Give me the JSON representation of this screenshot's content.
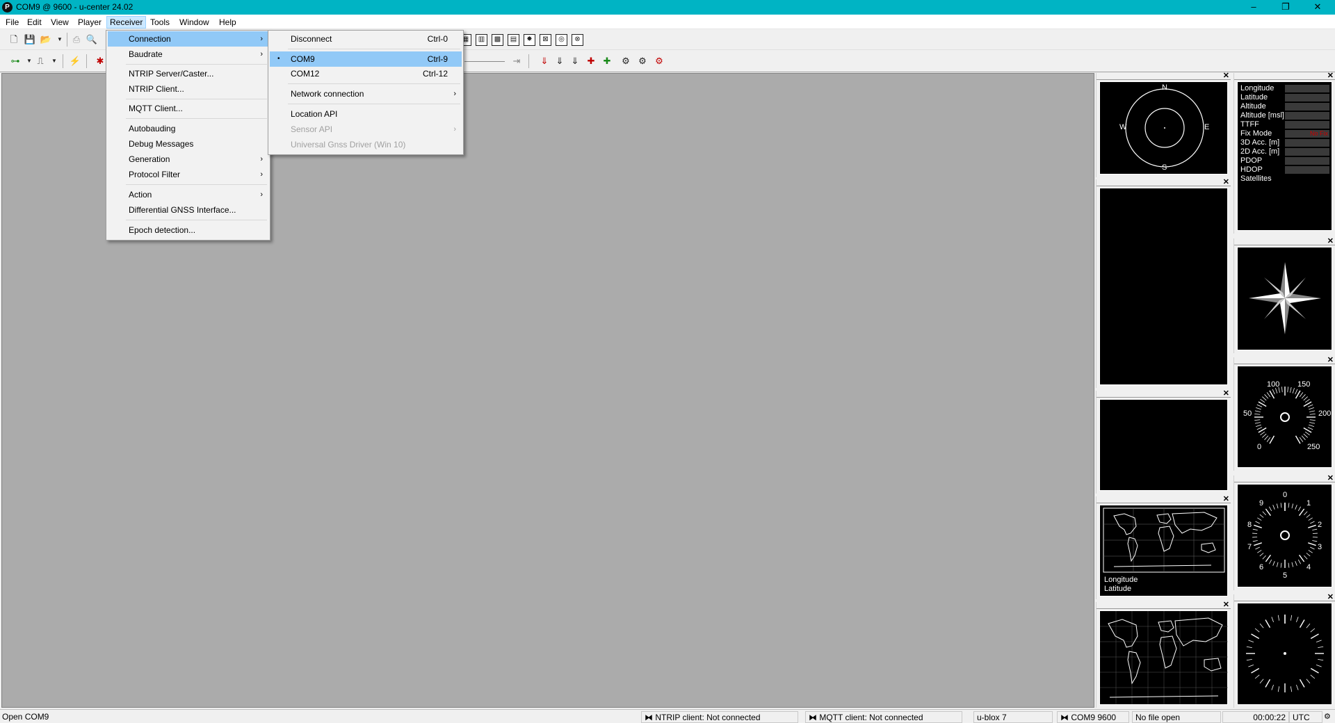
{
  "window": {
    "title": "COM9 @ 9600 - u-center 24.02",
    "app_icon": "P",
    "minimize_icon": "–",
    "maximize_icon": "❐",
    "close_icon": "✕"
  },
  "menubar": [
    "File",
    "Edit",
    "View",
    "Player",
    "Receiver",
    "Tools",
    "Window",
    "Help"
  ],
  "receiver_menu": {
    "items": [
      {
        "label": "Connection",
        "arrow": "›"
      },
      {
        "label": "Baudrate",
        "arrow": "›"
      },
      {
        "label": "NTRIP Server/Caster..."
      },
      {
        "label": "NTRIP Client..."
      },
      {
        "label": "MQTT Client..."
      },
      {
        "label": "Autobauding"
      },
      {
        "label": "Debug Messages"
      },
      {
        "label": "Generation",
        "arrow": "›"
      },
      {
        "label": "Protocol Filter",
        "arrow": "›"
      },
      {
        "label": "Action",
        "arrow": "›"
      },
      {
        "label": "Differential GNSS Interface..."
      },
      {
        "label": "Epoch detection..."
      }
    ]
  },
  "connection_menu": {
    "items": [
      {
        "label": "Disconnect",
        "shortcut": "Ctrl-0"
      },
      {
        "label": "COM9",
        "shortcut": "Ctrl-9",
        "bullet": "•"
      },
      {
        "label": "COM12",
        "shortcut": "Ctrl-12"
      },
      {
        "label": "Network connection",
        "arrow": "›"
      },
      {
        "label": "Location API"
      },
      {
        "label": "Sensor API",
        "arrow": "›"
      },
      {
        "label": "Universal Gnss Driver (Win 10)"
      }
    ]
  },
  "sky_view": {
    "n": "N",
    "s": "S",
    "e": "E",
    "w": "W"
  },
  "data_panel": {
    "labels": [
      "Longitude",
      "Latitude",
      "Altitude",
      "Altitude [msl]",
      "TTFF",
      "Fix Mode",
      "3D Acc. [m]",
      "2D Acc. [m]",
      "PDOP",
      "HDOP",
      "Satellites"
    ],
    "fix_mode_value": "No Fix"
  },
  "speed_gauge": {
    "ticks": [
      "100",
      "150",
      "50",
      "200",
      "0",
      "250"
    ]
  },
  "clock_gauge": {
    "ticks": [
      "0",
      "1",
      "2",
      "3",
      "4",
      "5",
      "6",
      "7",
      "8",
      "9"
    ]
  },
  "world_map_small": {
    "longitude_label": "Longitude",
    "latitude_label": "Latitude"
  },
  "status_bar": {
    "message": "Open COM9",
    "ntrip": "NTRIP client: Not connected",
    "mqtt": "MQTT client: Not connected",
    "receiver": "u-blox 7",
    "port": "COM9 9600",
    "file": "No file open",
    "time": "00:00:22",
    "tz": "UTC"
  },
  "colors": {
    "titlebar": "#00b4c4",
    "highlight": "#91c9f7",
    "workspace": "#ababab",
    "fix_mode": "#cc0000"
  }
}
